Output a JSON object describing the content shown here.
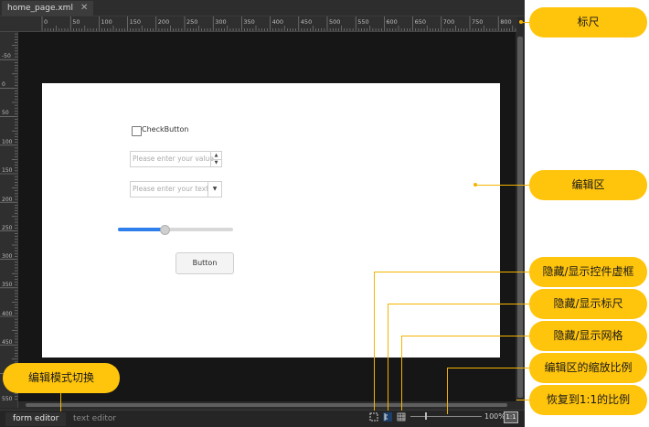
{
  "tab": {
    "title": "home_page.xml",
    "close": "✕"
  },
  "ruler": {
    "top_ticks": [
      "0",
      "50",
      "100",
      "150",
      "200",
      "250",
      "300",
      "350",
      "400",
      "450",
      "500",
      "550",
      "600",
      "650",
      "700",
      "750",
      "800"
    ],
    "left_ticks": [
      "-50",
      "0",
      "50",
      "100",
      "150",
      "200",
      "250",
      "300",
      "350",
      "400",
      "450",
      "550"
    ]
  },
  "form": {
    "checkbox_label": "CheckButton",
    "spin_placeholder": "Please enter your value",
    "combo_placeholder": "Please enter your text",
    "slider_value": 0.4,
    "button_label": "Button"
  },
  "status": {
    "mode_active": "form editor",
    "mode_inactive": "text editor",
    "zoom": "100%",
    "reset": "1:1"
  },
  "callouts": {
    "ruler": "标尺",
    "edit_area": "编辑区",
    "toggle_dashed": "隐藏/显示控件虚框",
    "toggle_ruler": "隐藏/显示标尺",
    "toggle_grid": "隐藏/显示网格",
    "zoom_ratio": "编辑区的缩放比例",
    "reset_ratio": "恢复到1:1的比例",
    "mode_switch": "编辑模式切换"
  },
  "colors": {
    "accent": "#ffc40c",
    "slider": "#2f80ed",
    "canvas": "#161616"
  }
}
